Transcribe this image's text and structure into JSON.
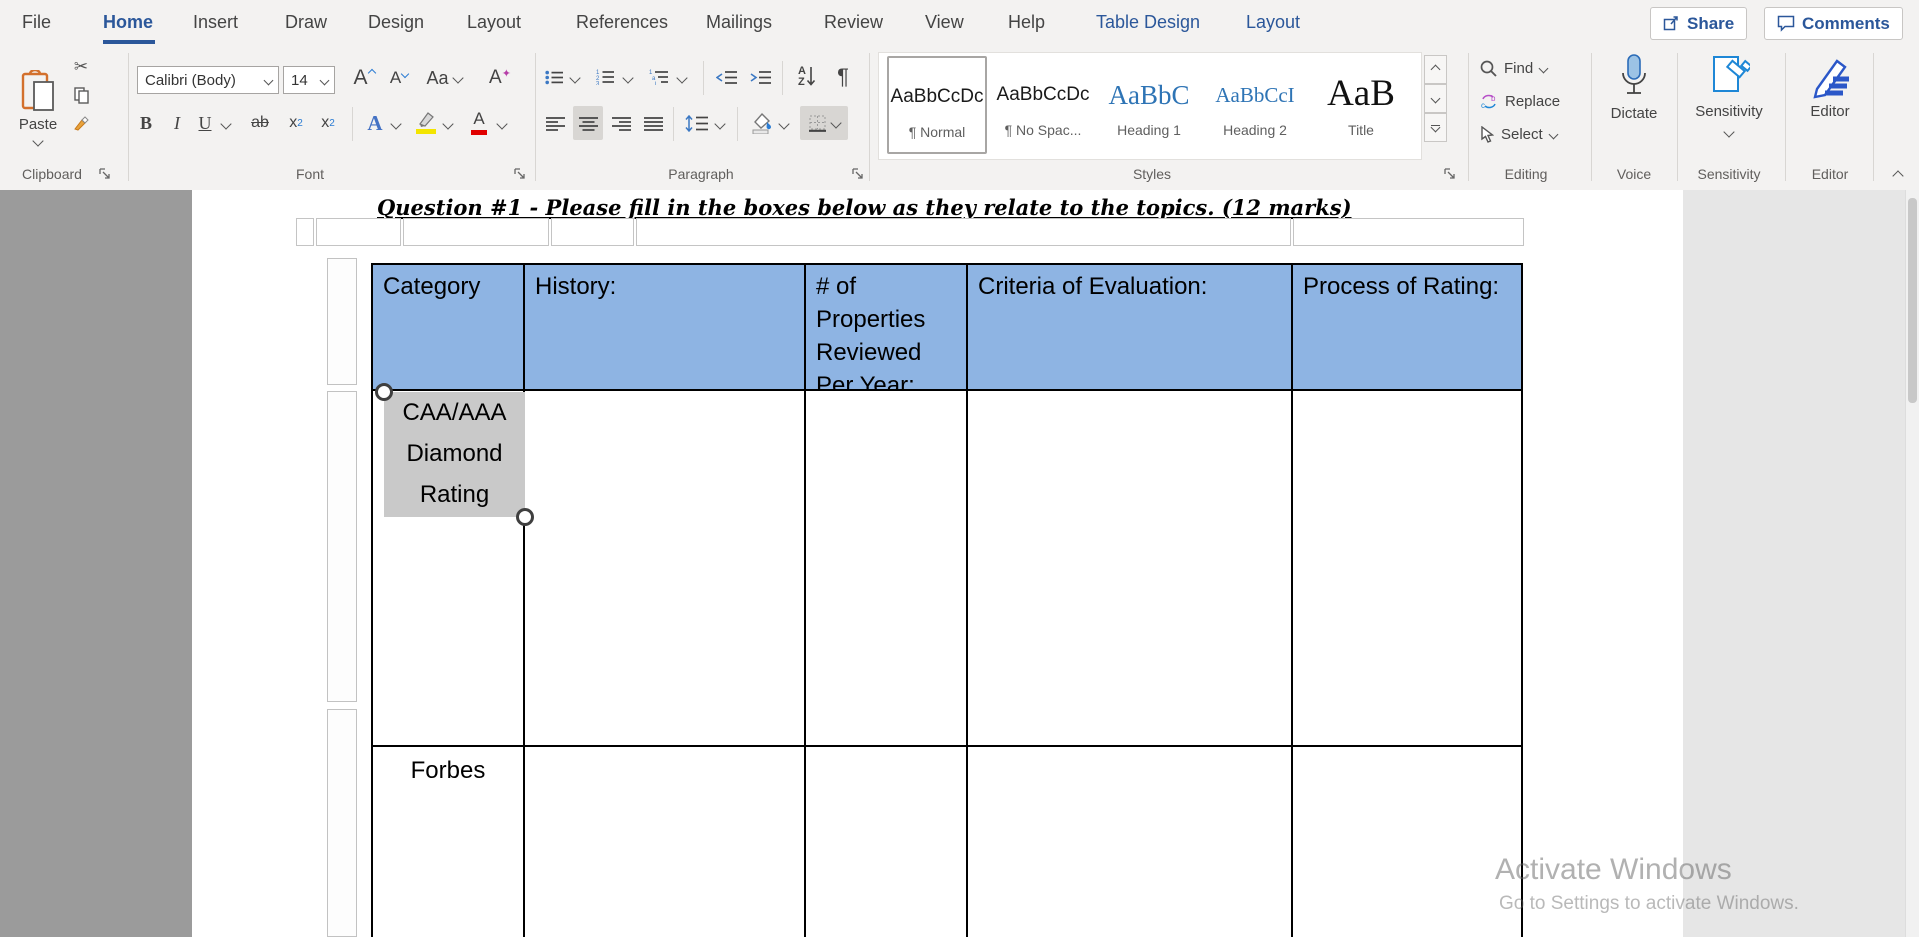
{
  "menu": {
    "items": [
      "File",
      "Home",
      "Insert",
      "Draw",
      "Design",
      "Layout",
      "References",
      "Mailings",
      "Review",
      "View",
      "Help",
      "Table Design",
      "Layout"
    ],
    "active": "Home"
  },
  "topbar": {
    "share": "Share",
    "comments": "Comments"
  },
  "ribbon": {
    "clipboard": {
      "label": "Clipboard",
      "paste": "Paste"
    },
    "font": {
      "label": "Font",
      "name": "Calibri (Body)",
      "size": "14",
      "bold": "B",
      "italic": "I",
      "underline": "U",
      "strike": "ab",
      "sub_base": "x",
      "sub_mark": "2",
      "sup_base": "x",
      "sup_mark": "2",
      "grow": "A",
      "shrink": "A",
      "case": "Aa",
      "clear": "A",
      "effects": "A",
      "color": "A"
    },
    "paragraph": {
      "label": "Paragraph",
      "pilcrow": "¶",
      "sort_a": "A",
      "sort_z": "Z"
    },
    "styles": {
      "label": "Styles",
      "items": [
        {
          "preview": "AaBbCcDc",
          "name": "¶ Normal"
        },
        {
          "preview": "AaBbCcDc",
          "name": "¶ No Spac..."
        },
        {
          "preview": "AaBbC",
          "name": "Heading 1"
        },
        {
          "preview": "AaBbCcI",
          "name": "Heading 2"
        },
        {
          "preview": "AaB",
          "name": "Title"
        }
      ]
    },
    "editing": {
      "label": "Editing",
      "find": "Find",
      "replace": "Replace",
      "select": "Select"
    },
    "voice": {
      "label": "Voice",
      "dictate": "Dictate"
    },
    "sensitivity": {
      "label": "Sensitivity",
      "button": "Sensitivity"
    },
    "editor": {
      "label": "Editor",
      "button": "Editor"
    }
  },
  "document": {
    "title": "Question #1 - Please fill in the boxes below as they relate to the topics. (12 marks)",
    "table": {
      "headers": [
        "Category",
        "History:",
        "# of Properties Reviewed Per Year:",
        "Criteria of Evaluation:",
        "Process of Rating:"
      ],
      "row1_label": "CAA/AAA Diamond Rating",
      "row2_label": "Forbes",
      "header_bg": "#8EB4E3"
    },
    "watermark": {
      "line1": "Activate Windows",
      "line2": "Go to Settings to activate Windows."
    }
  },
  "colors": {
    "accent": "#2b579a",
    "table_header": "#8EB4E3",
    "selection_gray": "#c9c9c9",
    "highlight_yellow": "#f3e500",
    "font_red": "#e00000"
  }
}
